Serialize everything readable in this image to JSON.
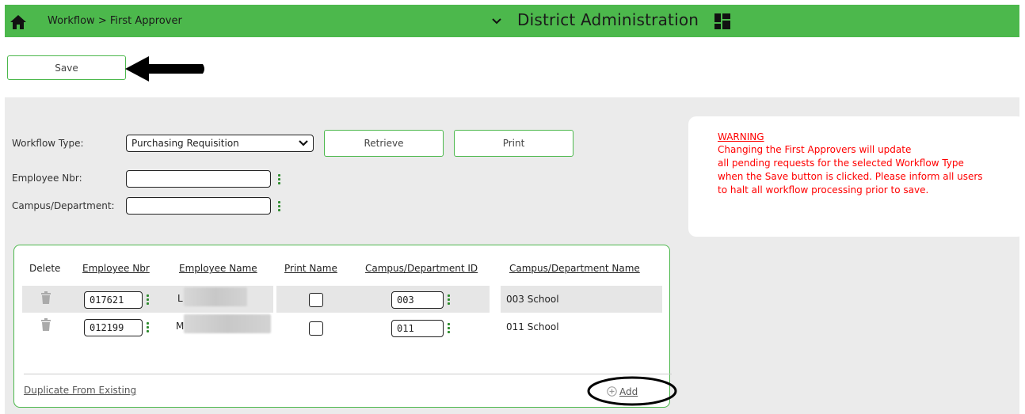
{
  "header": {
    "breadcrumb": "Workflow > First Approver",
    "app_title": "District Administration"
  },
  "toolbar": {
    "save_label": "Save"
  },
  "filters": {
    "workflow_type_label": "Workflow Type:",
    "workflow_type_value": "Purchasing Requisition",
    "employee_nbr_label": "Employee Nbr:",
    "employee_nbr_value": "",
    "campus_department_label": "Campus/Department:",
    "campus_department_value": "",
    "retrieve_label": "Retrieve",
    "print_label": "Print"
  },
  "warning": {
    "title": "WARNING",
    "lines": [
      "Changing the First Approvers will update",
      "all pending requests for the selected Workflow Type",
      "when the Save button is clicked. Please inform all users",
      "to halt all workflow processing prior to save."
    ]
  },
  "table": {
    "headers": {
      "delete": "Delete",
      "employee_nbr": "Employee Nbr",
      "employee_name": "Employee Name",
      "print_name": "Print Name",
      "campus_id": "Campus/Department ID",
      "campus_name": "Campus/Department Name"
    },
    "rows": [
      {
        "employee_nbr": "017621",
        "name_initial": "L",
        "campus_id": "003",
        "campus_name": "003 School",
        "print_name": false
      },
      {
        "employee_nbr": "012199",
        "name_initial": "M",
        "campus_id": "011",
        "campus_name": "011 School",
        "print_name": false
      }
    ],
    "duplicate_link": "Duplicate From Existing",
    "add_link": "Add"
  },
  "colors": {
    "brand_green": "#4cb84c",
    "warning_red": "#ff0000",
    "panel_grey": "#ebebeb"
  }
}
